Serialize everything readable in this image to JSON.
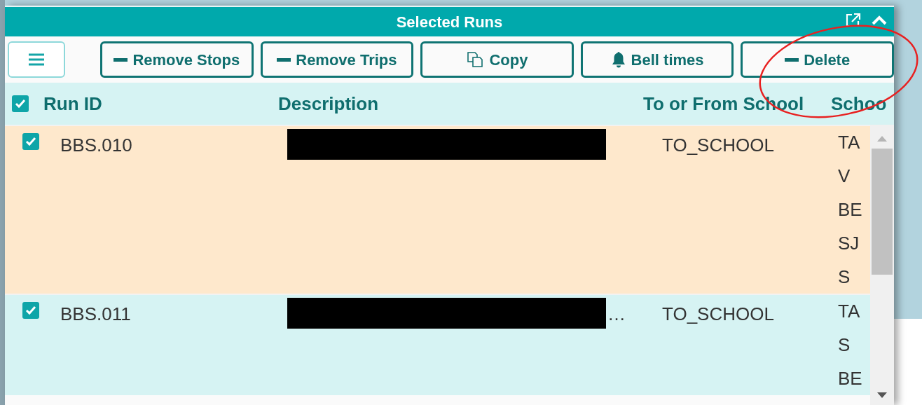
{
  "panel": {
    "title": "Selected Runs"
  },
  "toolbar": [
    {
      "kind": "menu"
    },
    {
      "kind": "minus",
      "label": "Remove Stops"
    },
    {
      "kind": "minus",
      "label": "Remove Trips"
    },
    {
      "kind": "copy",
      "label": "Copy"
    },
    {
      "kind": "bell",
      "label": "Bell times"
    },
    {
      "kind": "minus",
      "label": "Delete"
    }
  ],
  "table": {
    "select_all": {
      "checked": true
    },
    "columns": [
      "Run ID",
      "Description",
      "To or From School",
      "Schoo"
    ],
    "rows": [
      {
        "checked": true,
        "run_id": "BBS.010",
        "description": "",
        "to_or_from_school": "TO_SCHOOL",
        "schools": [
          "TA",
          "V",
          "BE",
          "SJ",
          "S"
        ],
        "color": "#fee8cc"
      },
      {
        "checked": true,
        "run_id": "BBS.011",
        "description": "…",
        "to_or_from_school": "TO_SCHOOL",
        "schools": [
          "TA",
          "S",
          "BE"
        ],
        "color": "#d6f3f3"
      }
    ]
  }
}
